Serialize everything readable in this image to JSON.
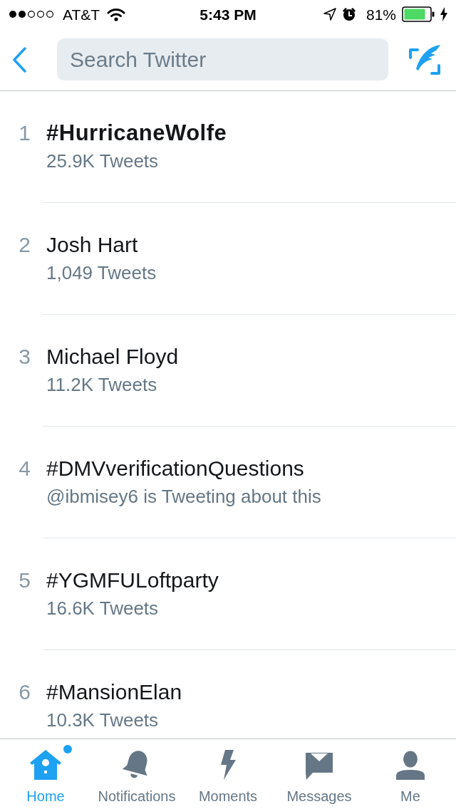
{
  "status_bar": {
    "carrier": "AT&T",
    "time": "5:43 PM",
    "battery_percent": "81%"
  },
  "search": {
    "placeholder": "Search Twitter"
  },
  "trends": [
    {
      "rank": "1",
      "name": "#HurricaneWolfe",
      "kind": "branded",
      "detail": "25.9K Tweets"
    },
    {
      "rank": "2",
      "name": "Josh Hart",
      "kind": "plain",
      "detail": "1,049 Tweets"
    },
    {
      "rank": "3",
      "name": "Michael Floyd",
      "kind": "plain",
      "detail": "11.2K Tweets"
    },
    {
      "rank": "4",
      "name": "#DMVverificationQuestions",
      "kind": "plain",
      "detail": "@ibmisey6 is Tweeting about this"
    },
    {
      "rank": "5",
      "name": "#YGMFULoftparty",
      "kind": "plain",
      "detail": "16.6K Tweets"
    },
    {
      "rank": "6",
      "name": "#MansionElan",
      "kind": "plain",
      "detail": "10.3K Tweets"
    }
  ],
  "tab_bar": [
    {
      "label": "Home",
      "selected": true,
      "badge": true
    },
    {
      "label": "Notifications",
      "selected": false,
      "badge": false
    },
    {
      "label": "Moments",
      "selected": false,
      "badge": false
    },
    {
      "label": "Messages",
      "selected": false,
      "badge": false
    },
    {
      "label": "Me",
      "selected": false,
      "badge": false
    }
  ]
}
